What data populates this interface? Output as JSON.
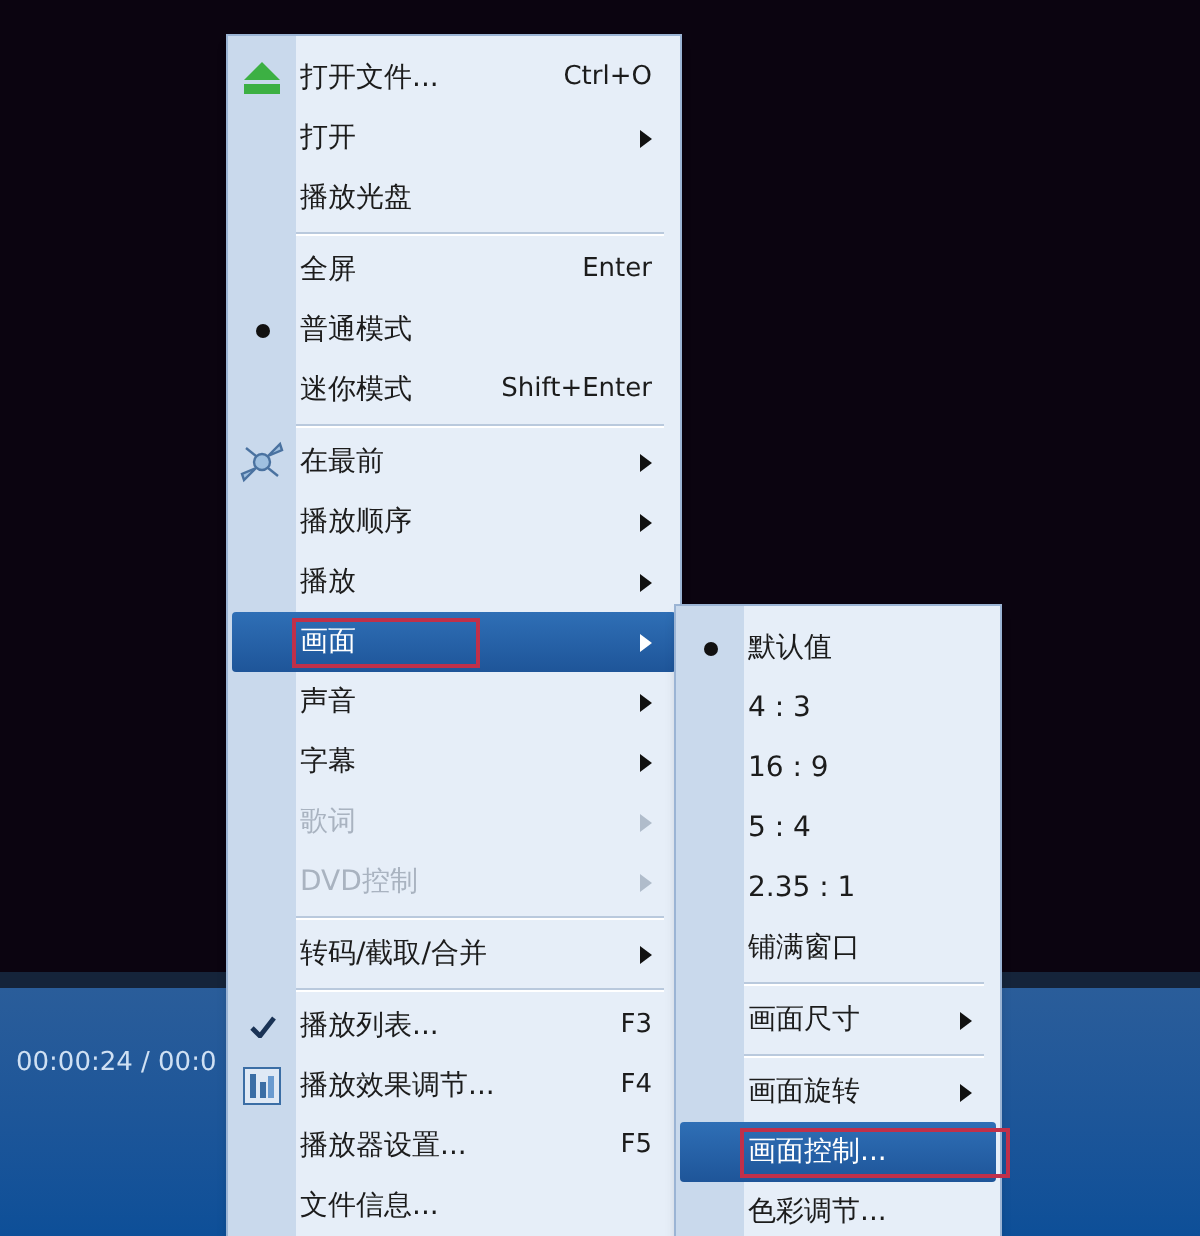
{
  "player": {
    "time": "00:00:24 / 00:0"
  },
  "menu": [
    {
      "label": "打开文件...",
      "shortcut": "Ctrl+O",
      "kind": "eject",
      "submenu": false,
      "disabled": false,
      "selected": false,
      "outlined": false
    },
    {
      "label": "打开",
      "submenu": true,
      "disabled": false,
      "selected": false,
      "outlined": false
    },
    {
      "label": "播放光盘",
      "submenu": false,
      "disabled": false,
      "selected": false,
      "outlined": false,
      "separator_after": true
    },
    {
      "label": "全屏",
      "shortcut": "Enter",
      "submenu": false,
      "disabled": false,
      "selected": false,
      "outlined": false
    },
    {
      "label": "普通模式",
      "kind": "bullet",
      "submenu": false,
      "disabled": false,
      "selected": false,
      "outlined": false
    },
    {
      "label": "迷你模式",
      "shortcut": "Shift+Enter",
      "submenu": false,
      "disabled": false,
      "selected": false,
      "outlined": false,
      "separator_after": true
    },
    {
      "label": "在最前",
      "kind": "pin",
      "submenu": true,
      "disabled": false,
      "selected": false,
      "outlined": false
    },
    {
      "label": "播放顺序",
      "submenu": true,
      "disabled": false,
      "selected": false,
      "outlined": false
    },
    {
      "label": "播放",
      "submenu": true,
      "disabled": false,
      "selected": false,
      "outlined": false
    },
    {
      "label": "画面",
      "submenu": true,
      "disabled": false,
      "selected": true,
      "outlined": true
    },
    {
      "label": "声音",
      "submenu": true,
      "disabled": false,
      "selected": false,
      "outlined": false
    },
    {
      "label": "字幕",
      "submenu": true,
      "disabled": false,
      "selected": false,
      "outlined": false
    },
    {
      "label": "歌词",
      "submenu": true,
      "disabled": true,
      "selected": false,
      "outlined": false
    },
    {
      "label": "DVD控制",
      "submenu": true,
      "disabled": true,
      "selected": false,
      "outlined": false,
      "separator_after": true
    },
    {
      "label": "转码/截取/合并",
      "submenu": true,
      "disabled": false,
      "selected": false,
      "outlined": false,
      "separator_after": true
    },
    {
      "label": "播放列表...",
      "shortcut": "F3",
      "kind": "check",
      "submenu": false,
      "disabled": false,
      "selected": false,
      "outlined": false
    },
    {
      "label": "播放效果调节...",
      "shortcut": "F4",
      "kind": "effects",
      "submenu": false,
      "disabled": false,
      "selected": false,
      "outlined": false
    },
    {
      "label": "播放器设置...",
      "shortcut": "F5",
      "submenu": false,
      "disabled": false,
      "selected": false,
      "outlined": false
    },
    {
      "label": "文件信息...",
      "submenu": false,
      "disabled": false,
      "selected": false,
      "outlined": false
    }
  ],
  "submenu": [
    {
      "label": "默认值",
      "kind": "bullet",
      "submenu": false,
      "selected": false,
      "outlined": false
    },
    {
      "label": "4 : 3",
      "submenu": false,
      "selected": false,
      "outlined": false
    },
    {
      "label": "16 : 9",
      "submenu": false,
      "selected": false,
      "outlined": false
    },
    {
      "label": "5 : 4",
      "submenu": false,
      "selected": false,
      "outlined": false
    },
    {
      "label": "2.35 : 1",
      "submenu": false,
      "selected": false,
      "outlined": false
    },
    {
      "label": "铺满窗口",
      "submenu": false,
      "selected": false,
      "outlined": false,
      "separator_after": true
    },
    {
      "label": "画面尺寸",
      "submenu": true,
      "selected": false,
      "outlined": false,
      "separator_after": true
    },
    {
      "label": "画面旋转",
      "submenu": true,
      "selected": false,
      "outlined": false
    },
    {
      "label": "画面控制...",
      "submenu": false,
      "selected": true,
      "outlined": true
    },
    {
      "label": "色彩调节...",
      "submenu": false,
      "selected": false,
      "outlined": false
    }
  ]
}
